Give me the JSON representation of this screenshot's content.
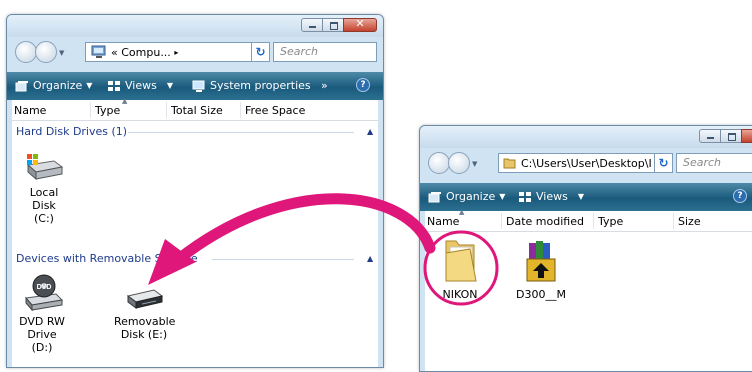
{
  "left_window": {
    "address": "Compu...",
    "address_prefix": "«",
    "address_chevron": "▸",
    "search_placeholder": "Search",
    "toolbar": {
      "organize": "Organize",
      "views": "Views",
      "system_properties": "System properties",
      "more": "»",
      "help": "?"
    },
    "columns": [
      "Name",
      "Type",
      "Total Size",
      "Free Space"
    ],
    "groups": [
      {
        "label": "Hard Disk Drives (1)",
        "items": [
          {
            "line1": "Local Disk",
            "line2": "(C:)"
          }
        ]
      },
      {
        "label": "Devices with Removable Storage",
        "items": [
          {
            "line1": "DVD RW",
            "line2": "Drive (D:)"
          },
          {
            "line1": "Removable",
            "line2": "Disk (E:)"
          }
        ]
      }
    ]
  },
  "right_window": {
    "address": "C:\\Users\\User\\Desktop\\I",
    "search_placeholder": "Search",
    "toolbar": {
      "organize": "Organize",
      "views": "Views",
      "help": "?"
    },
    "columns": [
      "Name",
      "Date modified",
      "Type",
      "Size"
    ],
    "items": [
      {
        "label": "NIKON"
      },
      {
        "label": "D300__M"
      }
    ]
  },
  "icon_labels": {
    "dvd": "DVD"
  },
  "colors": {
    "arrow": "#e0177a",
    "toolbar": "#1a5a7c",
    "group_text": "#1e3b8c"
  }
}
